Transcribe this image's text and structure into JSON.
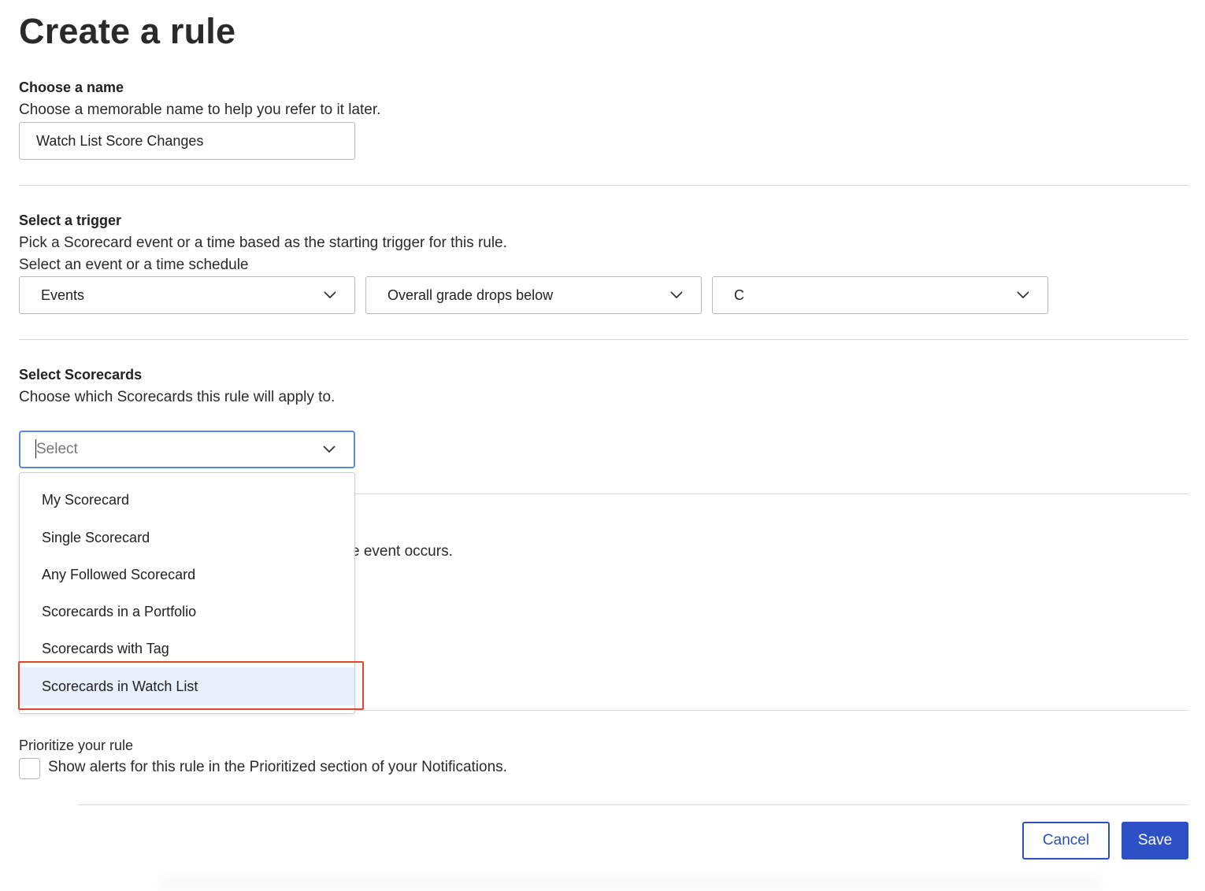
{
  "page": {
    "title": "Create a rule"
  },
  "name_section": {
    "heading": "Choose a name",
    "description": "Choose a memorable name to help you refer to it later.",
    "input_value": "Watch List Score Changes"
  },
  "trigger_section": {
    "heading": "Select a trigger",
    "description": "Pick a Scorecard event or a time based as the starting trigger for this rule.",
    "sublabel": "Select an event or a time schedule",
    "event_type_value": "Events",
    "event_value": "Overall grade drops below",
    "grade_value": "C"
  },
  "scorecards_section": {
    "heading": "Select Scorecards",
    "description": "Choose which Scorecards this rule will apply to.",
    "select_placeholder": "Select",
    "options": [
      "My Scorecard",
      "Single Scorecard",
      "Any Followed Scorecard",
      "Scorecards in a Portfolio",
      "Scorecards with Tag",
      "Scorecards in Watch List"
    ],
    "highlighted_option": "Scorecards in Watch List"
  },
  "action_section": {
    "partial_description": "e event occurs."
  },
  "prioritize_section": {
    "heading": "Prioritize your rule",
    "checkbox_label": "Show alerts for this rule in the Prioritized section of your Notifications.",
    "checked": false
  },
  "footer": {
    "cancel_label": "Cancel",
    "save_label": "Save"
  },
  "colors": {
    "primary": "#2d50c4",
    "focus_border": "#5b86e5",
    "highlight_bg": "#e8effc",
    "annotation": "#e0452f"
  }
}
